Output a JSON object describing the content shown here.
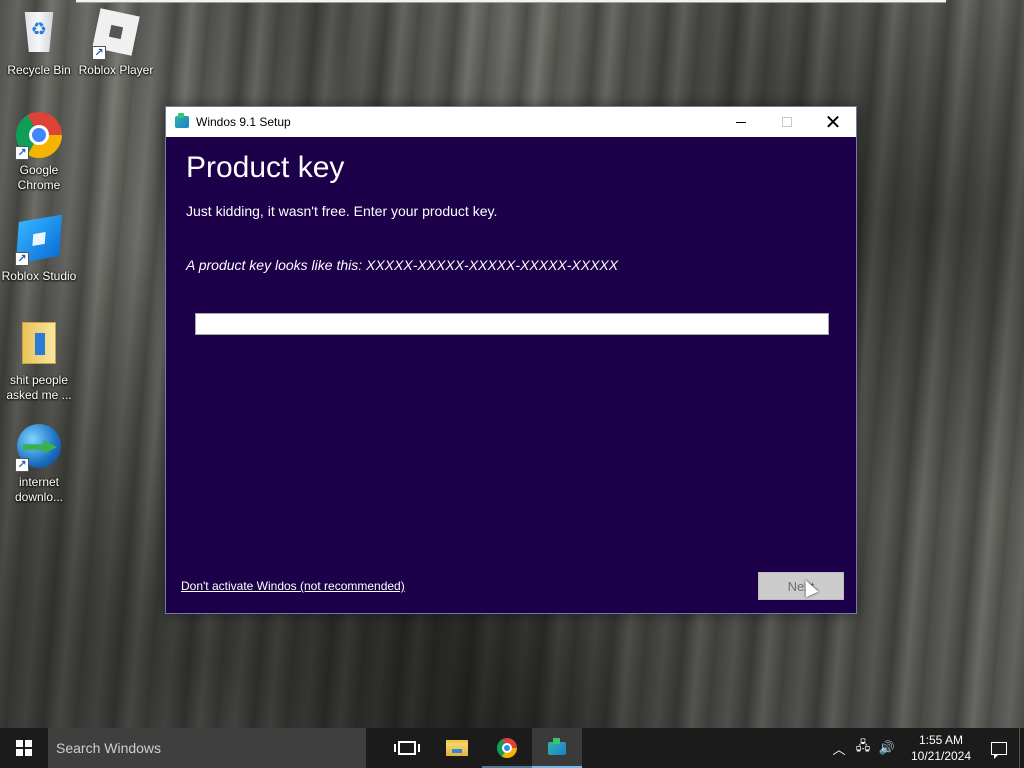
{
  "desktop": {
    "icons": [
      {
        "label": "Recycle Bin",
        "icon": "recycle-bin-icon"
      },
      {
        "label": "Roblox Player",
        "icon": "roblox-player-icon"
      },
      {
        "label": "Google Chrome",
        "icon": "google-chrome-icon"
      },
      {
        "label": "Roblox Studio",
        "icon": "roblox-studio-icon"
      },
      {
        "label": "shit people asked me ...",
        "icon": "folder-icon"
      },
      {
        "label": "internet downlo...",
        "icon": "internet-download-manager-icon"
      }
    ]
  },
  "window": {
    "title": "Windos 9.1 Setup",
    "heading": "Product key",
    "subheading": "Just kidding, it wasn't free. Enter your product key.",
    "hint": "A product key looks like this: XXXXX-XXXXX-XXXXX-XXXXX-XXXXX",
    "key_value": "",
    "skip_link": "Don't activate Windos (not recommended)",
    "next_label": "Next",
    "next_enabled": false,
    "background_color": "#1c0049"
  },
  "taskbar": {
    "search_placeholder": "Search Windows",
    "pinned": [
      {
        "name": "task-view",
        "active": false
      },
      {
        "name": "file-explorer",
        "active": false
      },
      {
        "name": "google-chrome",
        "active": false
      },
      {
        "name": "windos-setup",
        "active": true
      }
    ],
    "tray": {
      "time": "1:55 AM",
      "date": "10/21/2024"
    },
    "background_color": "#1b1b1b"
  }
}
